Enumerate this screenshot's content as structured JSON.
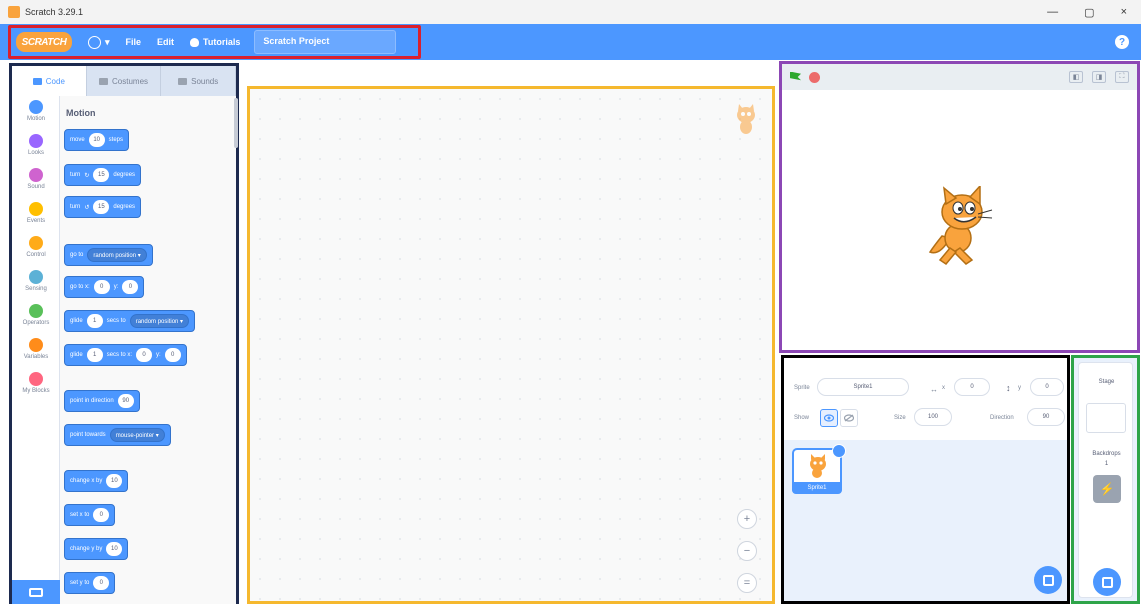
{
  "window": {
    "title": "Scratch 3.29.1",
    "minimize": "—",
    "restore": "▢",
    "close": "×"
  },
  "menubar": {
    "logo_text": "SCRATCH",
    "language_caret": "▾",
    "file": "File",
    "edit": "Edit",
    "tutorials": "Tutorials",
    "project_title": "Scratch Project",
    "help": "?"
  },
  "tabs": {
    "code": "Code",
    "costumes": "Costumes",
    "sounds": "Sounds"
  },
  "categories": [
    {
      "label": "Motion",
      "color": "#4c97ff"
    },
    {
      "label": "Looks",
      "color": "#9966ff"
    },
    {
      "label": "Sound",
      "color": "#cf63cf"
    },
    {
      "label": "Events",
      "color": "#ffbf00"
    },
    {
      "label": "Control",
      "color": "#ffab19"
    },
    {
      "label": "Sensing",
      "color": "#5cb1d6"
    },
    {
      "label": "Operators",
      "color": "#59c059"
    },
    {
      "label": "Variables",
      "color": "#ff8c1a"
    },
    {
      "label": "My Blocks",
      "color": "#ff6680"
    }
  ],
  "palette": {
    "title": "Motion",
    "blocks": {
      "move": {
        "pre": "move",
        "v1": "10",
        "post": "steps"
      },
      "turn_right": {
        "pre": "turn",
        "icon": "↻",
        "v1": "15",
        "post": "degrees"
      },
      "turn_left": {
        "pre": "turn",
        "icon": "↺",
        "v1": "15",
        "post": "degrees"
      },
      "goto": {
        "pre": "go to",
        "dd": "random position ▾"
      },
      "gotoxy": {
        "pre": "go to x:",
        "v1": "0",
        "mid": "y:",
        "v2": "0"
      },
      "glide_to": {
        "pre": "glide",
        "v1": "1",
        "mid": "secs to",
        "dd": "random position ▾"
      },
      "glide_xy": {
        "pre": "glide",
        "v1": "1",
        "mid": "secs to x:",
        "v2": "0",
        "mid2": "y:",
        "v3": "0"
      },
      "point_dir": {
        "pre": "point in direction",
        "v1": "90"
      },
      "point_towards": {
        "pre": "point towards",
        "dd": "mouse-pointer ▾"
      },
      "change_x": {
        "pre": "change x by",
        "v1": "10"
      },
      "set_x": {
        "pre": "set x to",
        "v1": "0"
      },
      "change_y": {
        "pre": "change y by",
        "v1": "10"
      },
      "set_y": {
        "pre": "set y to",
        "v1": "0"
      }
    }
  },
  "zoom": {
    "in": "+",
    "out": "−",
    "reset": "="
  },
  "stage_buttons": {
    "small": "◧",
    "large": "◨",
    "full": "⛶"
  },
  "sprite_info": {
    "sprite_label": "Sprite",
    "sprite_name": "Sprite1",
    "x_label": "x",
    "x_arrow": "↔",
    "x_value": "0",
    "y_label": "y",
    "y_arrow": "↕",
    "y_value": "0",
    "show_label": "Show",
    "size_label": "Size",
    "size_value": "100",
    "direction_label": "Direction",
    "direction_value": "90"
  },
  "sprite_tile": {
    "name": "Sprite1"
  },
  "stage_pane": {
    "title": "Stage",
    "backdrops_label": "Backdrops",
    "backdrops_count": "1"
  },
  "colors": {
    "menubar": "#4c97ff",
    "motion": "#4c97ff",
    "highlight_red": "#d9202e",
    "highlight_navy": "#1d2a4f",
    "highlight_yellow": "#f5b82e",
    "highlight_purple": "#8c47b5",
    "highlight_black": "#000000",
    "highlight_green": "#2ea449"
  }
}
